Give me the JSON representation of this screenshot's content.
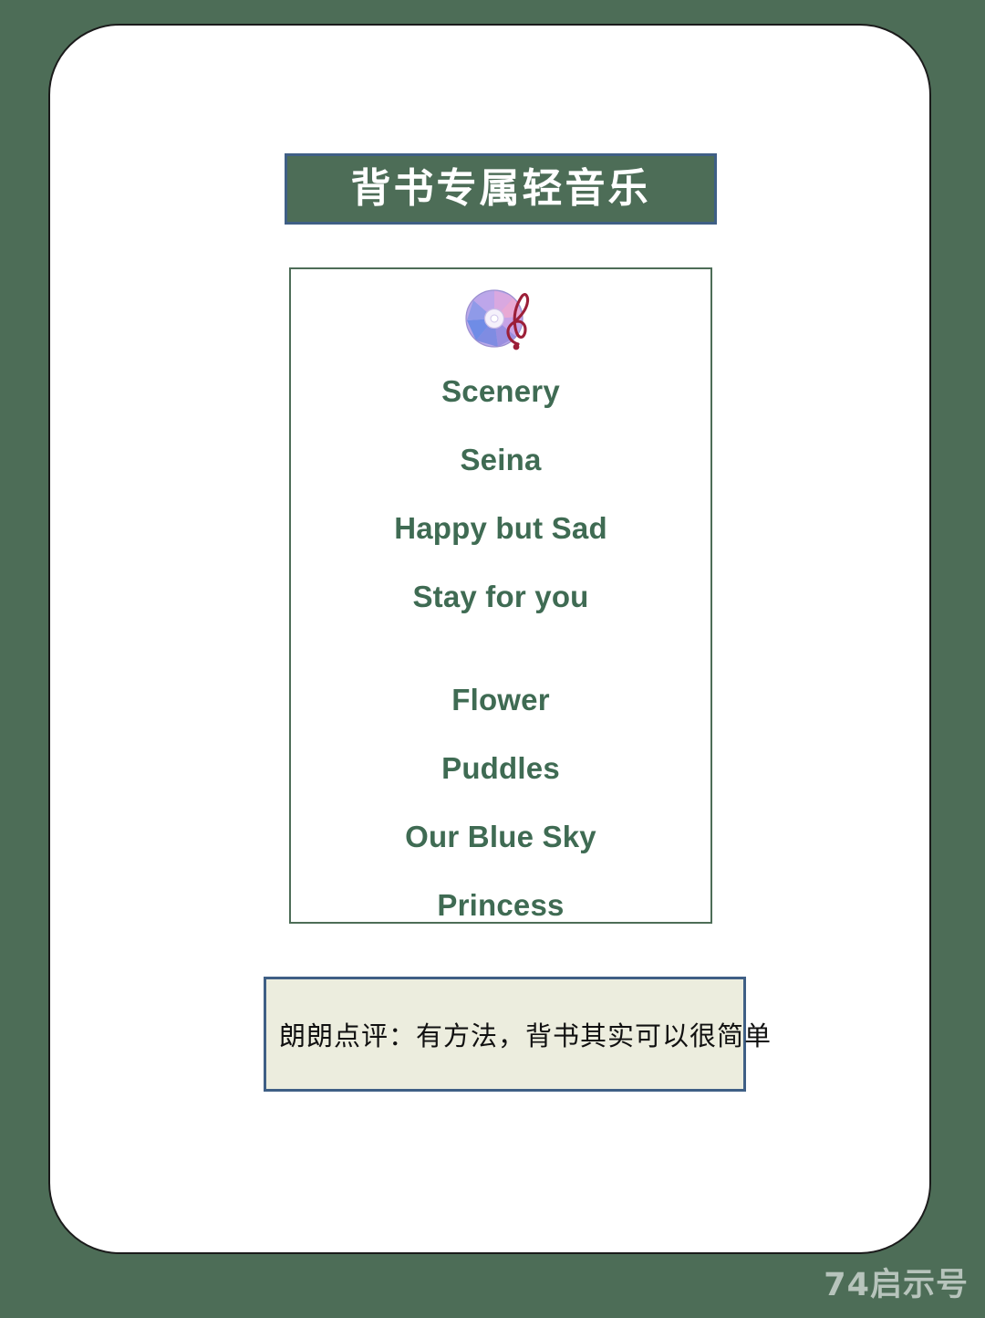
{
  "page": {
    "background_color": "#4d6d57",
    "card_background": "#ffffff"
  },
  "title": {
    "text": "背书专属轻音乐",
    "fill_color": "#4d6d57",
    "border_color": "#3f5f85",
    "text_color": "#ffffff"
  },
  "playlist": {
    "icon_name": "cd-music-icon",
    "border_color": "#4d6d57",
    "text_color": "#3f6b53",
    "songs": [
      {
        "label": "Scenery",
        "gap_after": false
      },
      {
        "label": "Seina",
        "gap_after": false
      },
      {
        "label": "Happy but Sad",
        "gap_after": false
      },
      {
        "label": "Stay for you",
        "gap_after": true
      },
      {
        "label": "Flower",
        "gap_after": false
      },
      {
        "label": "Puddles",
        "gap_after": false
      },
      {
        "label": "Our Blue Sky",
        "gap_after": false
      },
      {
        "label": "Princess",
        "gap_after": false
      }
    ]
  },
  "comment": {
    "text": "朗朗点评：有方法，背书其实可以很简单",
    "fill_color": "#ecedde",
    "border_color": "#3f5f85",
    "text_color": "#111111"
  },
  "watermark": {
    "text": "74启示号"
  }
}
